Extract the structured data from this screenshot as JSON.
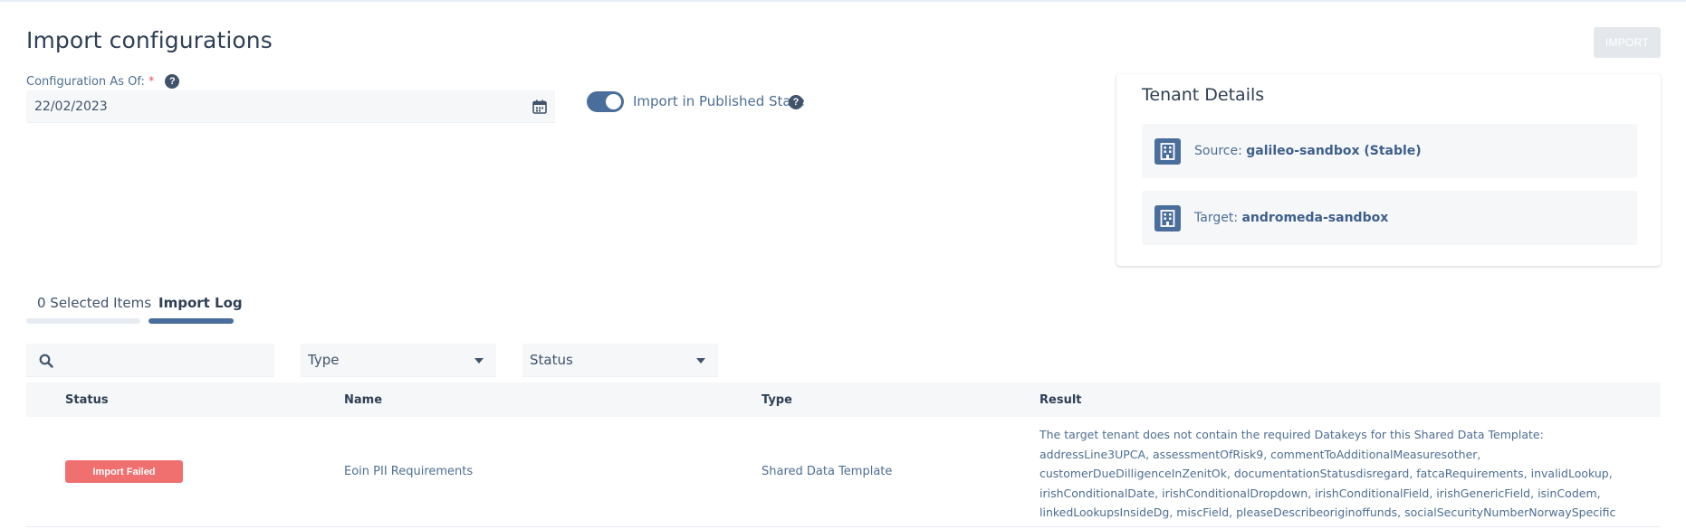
{
  "header": {
    "title": "Import configurations",
    "import_label": "IMPORT"
  },
  "form": {
    "config_label": "Configuration As Of:",
    "required_mark": "*",
    "date_value": "22/02/2023",
    "toggle_label": "Import in Published State",
    "toggle_on": true
  },
  "tenant": {
    "title": "Tenant Details",
    "source_prefix": "Source:",
    "source_value": "galileo-sandbox (Stable)",
    "target_prefix": "Target:",
    "target_value": "andromeda-sandbox"
  },
  "tabs": [
    {
      "label": "0 Selected Items",
      "active": false
    },
    {
      "label": "Import Log",
      "active": true
    }
  ],
  "filters": {
    "type_label": "Type",
    "status_label": "Status"
  },
  "table": {
    "headers": [
      "Status",
      "Name",
      "Type",
      "Result"
    ],
    "rows": [
      {
        "status": "Import Failed",
        "name": "Eoin PII Requirements",
        "type": "Shared Data Template",
        "result": "The target tenant does not contain the required Datakeys for this Shared Data Template: addressLine3UPCA, assessmentOfRisk9, commentToAdditionalMeasuresother, customerDueDilligenceInZenitOk, documentationStatusdisregard, fatcaRequirements, invalidLookup, irishConditionalDate, irishConditionalDropdown, irishConditionalField, irishGenericField, isinCodem, linkedLookupsInsideDg, miscField, pleaseDescribeoriginoffunds, socialSecurityNumberNorwaySpecific"
      }
    ]
  },
  "colors": {
    "accent": "#4a6e9c",
    "error": "#f06f6f",
    "surface": "#f5f7f9"
  }
}
